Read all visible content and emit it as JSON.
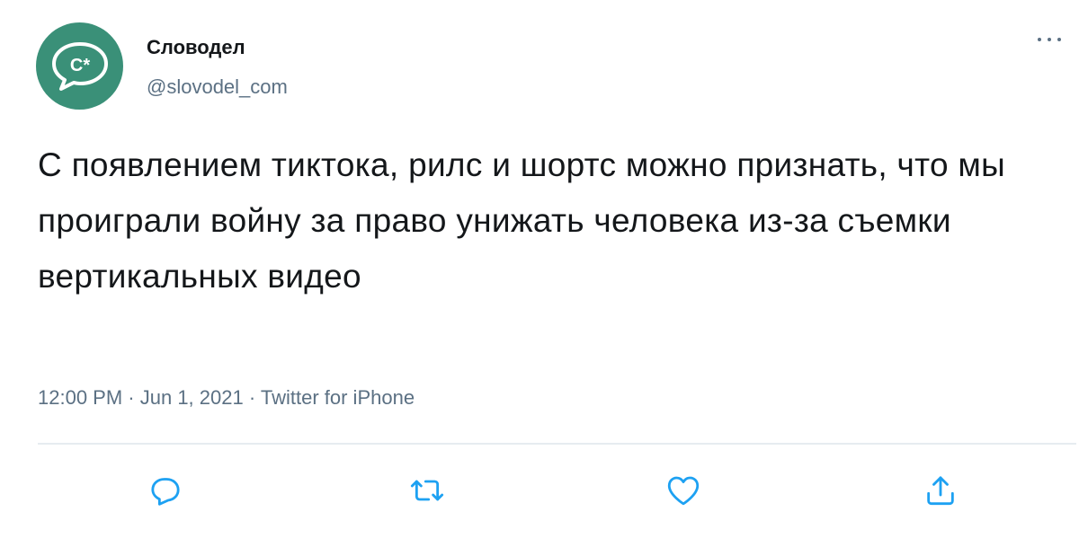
{
  "tweet": {
    "author_name": "Словодел",
    "author_handle": "@slovodel_com",
    "avatar_text": "C*",
    "text": "С появлением тиктока, рилс и шортс можно признать, что мы проиграли войну за право унижать человека из-за съемки вертикальных видео",
    "time": "12:00 PM",
    "date": "Jun 1, 2021",
    "source": "Twitter for iPhone",
    "separator": " · "
  },
  "colors": {
    "avatar_bg": "#3a9078",
    "secondary_text": "#5b7083",
    "primary_text": "#14171a",
    "icon": "#1da1f2"
  },
  "icons": {
    "more": "more-options-icon",
    "reply": "reply-icon",
    "retweet": "retweet-icon",
    "like": "like-icon",
    "share": "share-icon"
  }
}
